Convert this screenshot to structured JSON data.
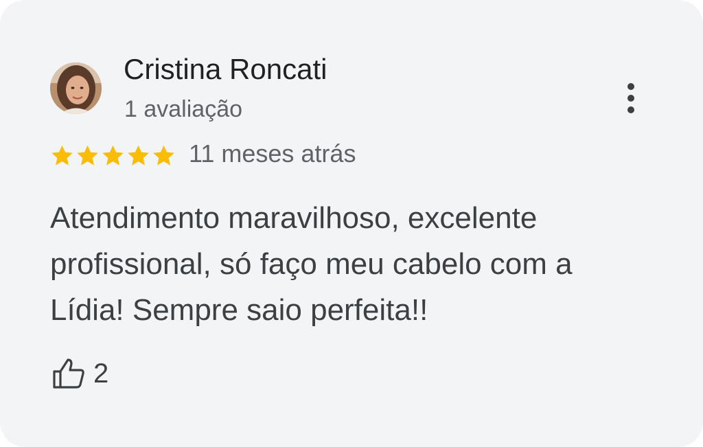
{
  "review": {
    "reviewer_name": "Cristina Roncati",
    "reviewer_meta": "1 avaliação",
    "rating": 5,
    "rating_max": 5,
    "star_color": "#fbbc04",
    "time_ago": "11 meses atrás",
    "text": "Atendimento maravilhoso, excelente profissional, só faço meu cabelo com a Lídia! Sempre saio perfeita!!",
    "like_count": "2"
  },
  "icons": {
    "avatar": "profile-photo",
    "menu": "more-vert-icon",
    "star": "star-icon",
    "like": "thumb-up-outline-icon"
  }
}
